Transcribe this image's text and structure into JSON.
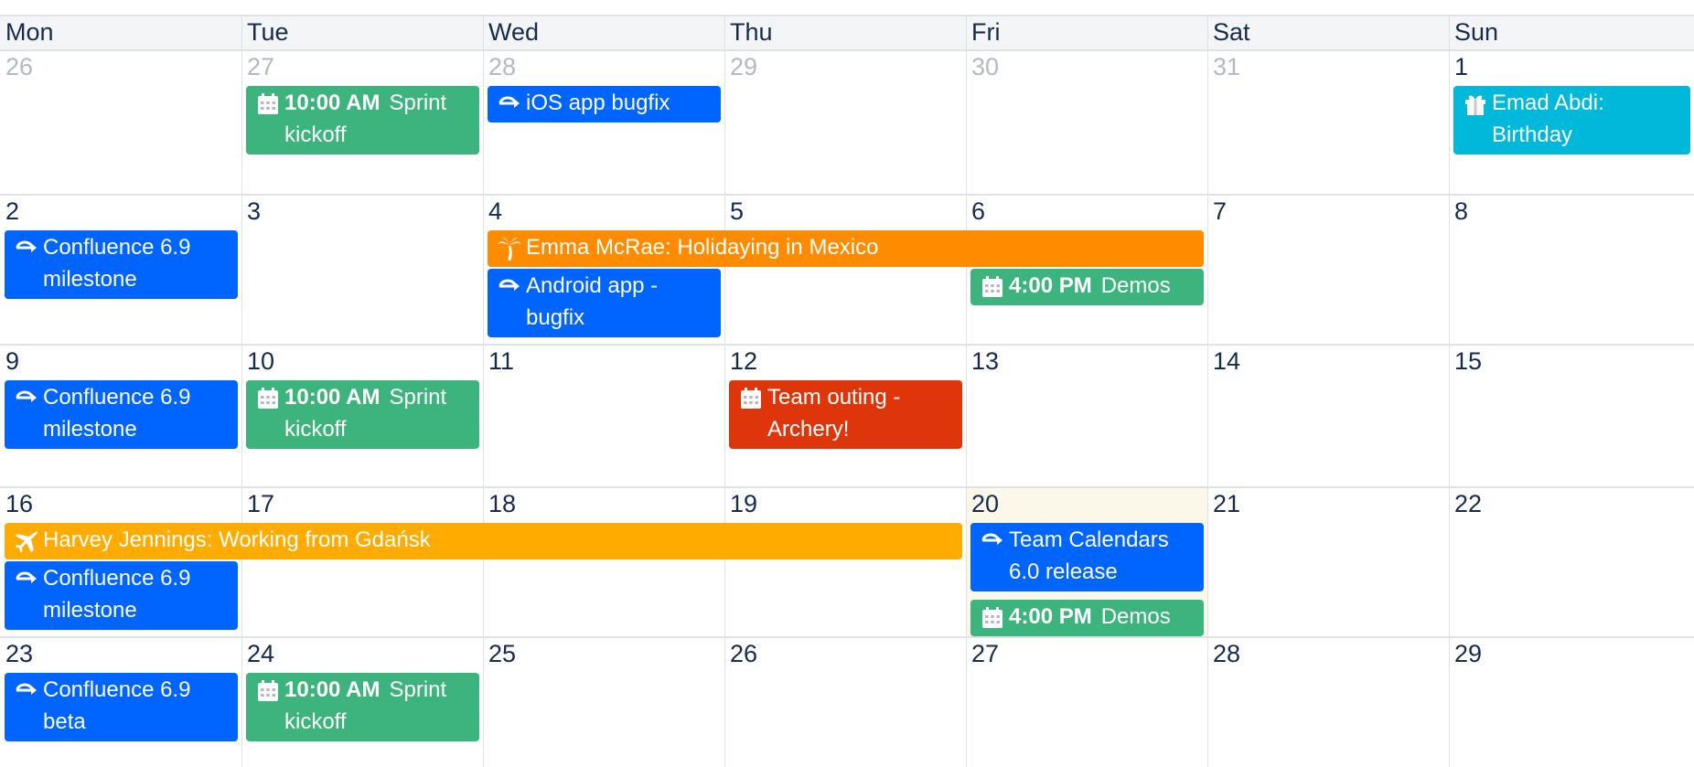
{
  "colors": {
    "grid": "#dfe1e6",
    "header_bg": "#f4f5f7",
    "today_bg": "#fcf8e9",
    "blue": "#0065ff",
    "green": "#3db37d",
    "cyan": "#00b8d9",
    "orange": "#ff8b00",
    "amber": "#ffab00",
    "red": "#de350b"
  },
  "weekdays": [
    "Mon",
    "Tue",
    "Wed",
    "Thu",
    "Fri",
    "Sat",
    "Sun"
  ],
  "weeks": [
    {
      "days": [
        {
          "label": "26",
          "other": true
        },
        {
          "label": "27",
          "other": true
        },
        {
          "label": "28",
          "other": true
        },
        {
          "label": "29",
          "other": true
        },
        {
          "label": "30",
          "other": true
        },
        {
          "label": "31",
          "other": true
        },
        {
          "label": "1",
          "other": false
        }
      ]
    },
    {
      "days": [
        {
          "label": "2",
          "other": false
        },
        {
          "label": "3",
          "other": false
        },
        {
          "label": "4",
          "other": false
        },
        {
          "label": "5",
          "other": false
        },
        {
          "label": "6",
          "other": false
        },
        {
          "label": "7",
          "other": false
        },
        {
          "label": "8",
          "other": false
        }
      ]
    },
    {
      "days": [
        {
          "label": "9",
          "other": false
        },
        {
          "label": "10",
          "other": false
        },
        {
          "label": "11",
          "other": false
        },
        {
          "label": "12",
          "other": false
        },
        {
          "label": "13",
          "other": false
        },
        {
          "label": "14",
          "other": false
        },
        {
          "label": "15",
          "other": false
        }
      ]
    },
    {
      "days": [
        {
          "label": "16",
          "other": false
        },
        {
          "label": "17",
          "other": false
        },
        {
          "label": "18",
          "other": false
        },
        {
          "label": "19",
          "other": false
        },
        {
          "label": "20",
          "other": false,
          "today": true
        },
        {
          "label": "21",
          "other": false
        },
        {
          "label": "22",
          "other": false
        }
      ]
    },
    {
      "days": [
        {
          "label": "23",
          "other": false
        },
        {
          "label": "24",
          "other": false
        },
        {
          "label": "25",
          "other": false
        },
        {
          "label": "26",
          "other": false
        },
        {
          "label": "27",
          "other": false
        },
        {
          "label": "28",
          "other": false
        },
        {
          "label": "29",
          "other": false
        }
      ]
    }
  ],
  "events": [
    {
      "week": 0,
      "day": 1,
      "span": 1,
      "slot": 0,
      "lines": 2,
      "color": "green",
      "icon": "calendar-icon",
      "time": "10:00 AM",
      "title": "Sprint kickoff"
    },
    {
      "week": 0,
      "day": 2,
      "span": 1,
      "slot": 0,
      "lines": 1,
      "color": "blue",
      "icon": "milestone-icon",
      "time": "",
      "title": "iOS app bugfix"
    },
    {
      "week": 0,
      "day": 6,
      "span": 1,
      "slot": 0,
      "lines": 2,
      "color": "cyan",
      "icon": "gift-icon",
      "time": "",
      "title": "Emad Abdi: Birthday"
    },
    {
      "week": 1,
      "day": 0,
      "span": 1,
      "slot": 0,
      "lines": 2,
      "color": "blue",
      "icon": "milestone-icon",
      "time": "",
      "title": "Confluence 6.9 milestone"
    },
    {
      "week": 1,
      "day": 2,
      "span": 3,
      "slot": 0,
      "lines": 1,
      "color": "orange",
      "icon": "palm-tree-icon",
      "time": "",
      "title": "Emma McRae: Holidaying in Mexico"
    },
    {
      "week": 1,
      "day": 2,
      "span": 1,
      "slot": 1,
      "lines": 2,
      "color": "blue",
      "icon": "milestone-icon",
      "time": "",
      "title": "Android app - bugfix"
    },
    {
      "week": 1,
      "day": 4,
      "span": 1,
      "slot": 1,
      "lines": 1,
      "color": "green",
      "icon": "calendar-icon",
      "time": "4:00 PM",
      "title": "Demos"
    },
    {
      "week": 2,
      "day": 0,
      "span": 1,
      "slot": 0,
      "lines": 2,
      "color": "blue",
      "icon": "milestone-icon",
      "time": "",
      "title": "Confluence 6.9 milestone"
    },
    {
      "week": 2,
      "day": 1,
      "span": 1,
      "slot": 0,
      "lines": 2,
      "color": "green",
      "icon": "calendar-icon",
      "time": "10:00 AM",
      "title": "Sprint kickoff"
    },
    {
      "week": 2,
      "day": 3,
      "span": 1,
      "slot": 0,
      "lines": 2,
      "color": "red",
      "icon": "calendar-icon",
      "time": "",
      "title": "Team outing - Archery!"
    },
    {
      "week": 3,
      "day": 0,
      "span": 4,
      "slot": 0,
      "lines": 1,
      "color": "amber",
      "icon": "airplane-icon",
      "time": "",
      "title": "Harvey Jennings: Working from Gdańsk"
    },
    {
      "week": 3,
      "day": 0,
      "span": 1,
      "slot": 1,
      "lines": 2,
      "color": "blue",
      "icon": "milestone-icon",
      "time": "",
      "title": "Confluence 6.9 milestone"
    },
    {
      "week": 3,
      "day": 4,
      "span": 1,
      "slot": 0,
      "lines": 2,
      "color": "blue",
      "icon": "milestone-icon",
      "time": "",
      "title": "Team Calendars 6.0 release"
    },
    {
      "week": 3,
      "day": 4,
      "span": 1,
      "slot": 2,
      "lines": 1,
      "color": "green",
      "icon": "calendar-icon",
      "time": "4:00 PM",
      "title": "Demos"
    },
    {
      "week": 4,
      "day": 0,
      "span": 1,
      "slot": 0,
      "lines": 2,
      "color": "blue",
      "icon": "milestone-icon",
      "time": "",
      "title": "Confluence 6.9 beta"
    },
    {
      "week": 4,
      "day": 1,
      "span": 1,
      "slot": 0,
      "lines": 2,
      "color": "green",
      "icon": "calendar-icon",
      "time": "10:00 AM",
      "title": "Sprint kickoff"
    }
  ]
}
